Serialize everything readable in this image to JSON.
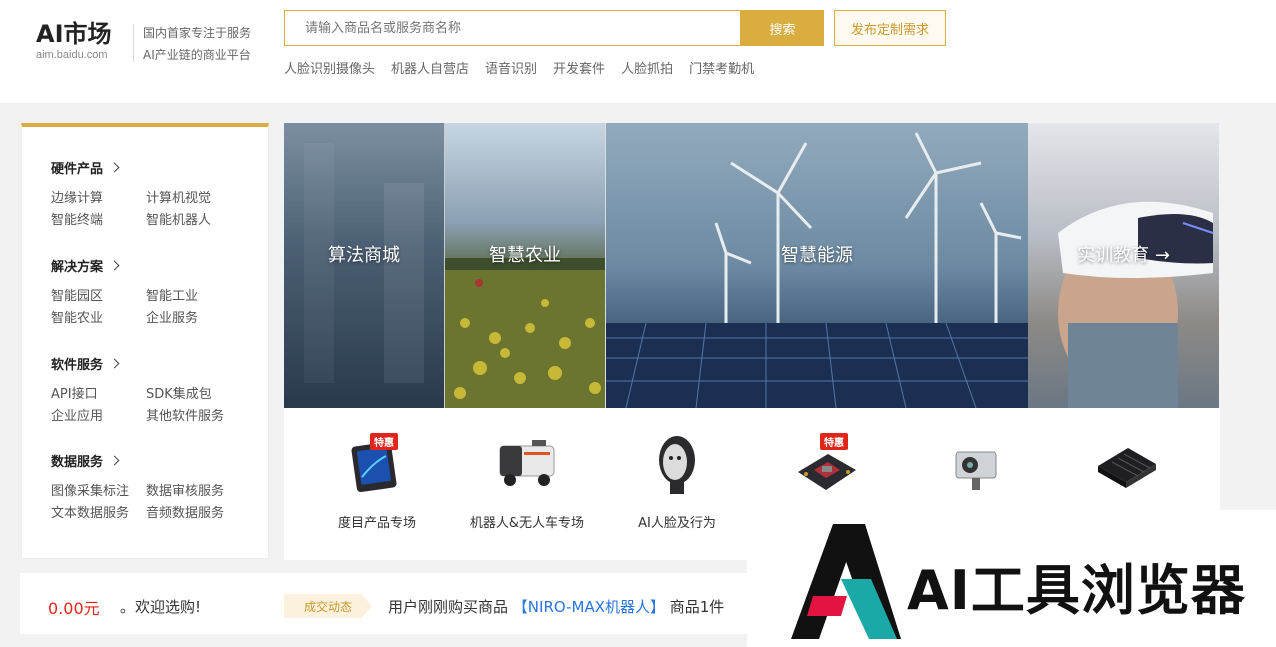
{
  "header": {
    "logo_main": "AI市场",
    "logo_sub": "aim.baidu.com",
    "slogan_1": "国内首家专注于服务",
    "slogan_2": "AI产业链的商业平台",
    "search_placeholder": "请输入商品名或服务商名称",
    "search_button": "搜索",
    "publish_button": "发布定制需求",
    "hot_words": [
      "人脸识别摄像头",
      "机器人自营店",
      "语音识别",
      "开发套件",
      "人脸抓拍",
      "门禁考勤机"
    ]
  },
  "sidebar": {
    "categories": [
      {
        "title": "硬件产品",
        "items": [
          "边缘计算",
          "计算机视觉",
          "智能终端",
          "智能机器人"
        ]
      },
      {
        "title": "解决方案",
        "items": [
          "智能园区",
          "智能工业",
          "智能农业",
          "企业服务"
        ]
      },
      {
        "title": "软件服务",
        "items": [
          "API接口",
          "SDK集成包",
          "企业应用",
          "其他软件服务"
        ]
      },
      {
        "title": "数据服务",
        "items": [
          "图像采集标注",
          "数据审核服务",
          "文本数据服务",
          "音频数据服务"
        ]
      }
    ]
  },
  "banner": {
    "panels": [
      "算法商城",
      "智慧农业",
      "智慧能源",
      "实训教育 →"
    ]
  },
  "products": [
    {
      "name": "度目产品专场",
      "badge": "特惠",
      "icon": "tablet-device-icon"
    },
    {
      "name": "机器人&无人车专场",
      "badge": "",
      "icon": "delivery-robot-icon"
    },
    {
      "name": "AI人脸及行为",
      "badge": "",
      "icon": "robot-face-icon"
    },
    {
      "name": "",
      "badge": "特惠",
      "icon": "circuit-board-icon"
    },
    {
      "name": "",
      "badge": "",
      "icon": "camera-module-icon"
    },
    {
      "name": "",
      "badge": "",
      "icon": "dev-board-icon"
    }
  ],
  "ticker": {
    "amount": "0.00元",
    "welcome": "。欢迎选购!",
    "tag": "成交动态",
    "deal_prefix": "用户刚刚购买商品",
    "deal_item": "【NIRO-MAX机器人】",
    "deal_suffix": "商品1件"
  },
  "overlay": {
    "text": "AI工具浏览器"
  },
  "colors": {
    "accent": "#d9ad3f",
    "price_red": "#e1251b",
    "link_blue": "#2a74e2"
  }
}
